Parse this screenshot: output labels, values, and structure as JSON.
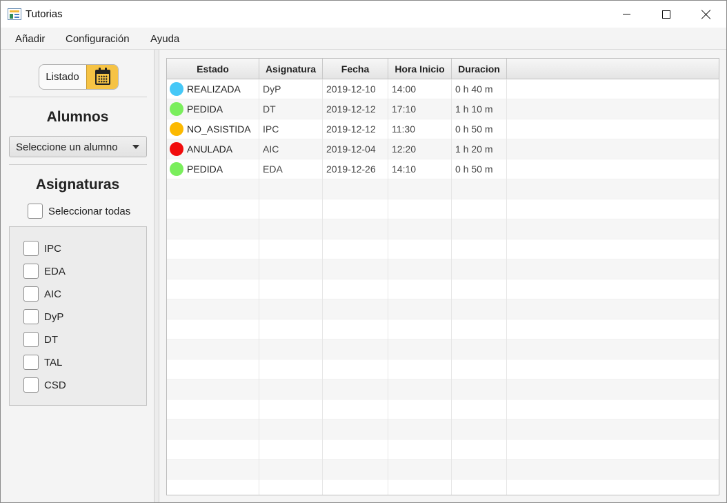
{
  "window": {
    "title": "Tutorias",
    "controls": [
      "minimize",
      "maximize",
      "close"
    ]
  },
  "menu": {
    "items": [
      {
        "label": "Añadir"
      },
      {
        "label": "Configuración"
      },
      {
        "label": "Ayuda"
      }
    ]
  },
  "sidebar": {
    "view_toggle": {
      "label": "Listado",
      "icon": "calendar-icon",
      "active_color": "#f6c344"
    },
    "alumnos": {
      "title": "Alumnos",
      "combo_value": "Seleccione un alumno"
    },
    "asignaturas": {
      "title": "Asignaturas",
      "select_all_label": "Seleccionar todas",
      "select_all_checked": false,
      "items": [
        {
          "label": "IPC",
          "checked": false
        },
        {
          "label": "EDA",
          "checked": false
        },
        {
          "label": "AIC",
          "checked": false
        },
        {
          "label": "DyP",
          "checked": false
        },
        {
          "label": "DT",
          "checked": false
        },
        {
          "label": "TAL",
          "checked": false
        },
        {
          "label": "CSD",
          "checked": false
        }
      ]
    }
  },
  "table": {
    "columns": [
      "Estado",
      "Asignatura",
      "Fecha",
      "Hora Inicio",
      "Duracion"
    ],
    "rows": [
      {
        "estado": "REALIZADA",
        "color": "#45c8f7",
        "asignatura": "DyP",
        "fecha": "2019-12-10",
        "hora": "14:00",
        "duracion": "0 h 40 m"
      },
      {
        "estado": "PEDIDA",
        "color": "#7aee5c",
        "asignatura": "DT",
        "fecha": "2019-12-12",
        "hora": "17:10",
        "duracion": "1 h 10 m"
      },
      {
        "estado": "NO_ASISTIDA",
        "color": "#fcb900",
        "asignatura": "IPC",
        "fecha": "2019-12-12",
        "hora": "11:30",
        "duracion": "0 h 50 m"
      },
      {
        "estado": "ANULADA",
        "color": "#f10c0c",
        "asignatura": "AIC",
        "fecha": "2019-12-04",
        "hora": "12:20",
        "duracion": "1 h 20 m"
      },
      {
        "estado": "PEDIDA",
        "color": "#7aee5c",
        "asignatura": "EDA",
        "fecha": "2019-12-26",
        "hora": "14:10",
        "duracion": "0 h 50 m"
      }
    ]
  }
}
